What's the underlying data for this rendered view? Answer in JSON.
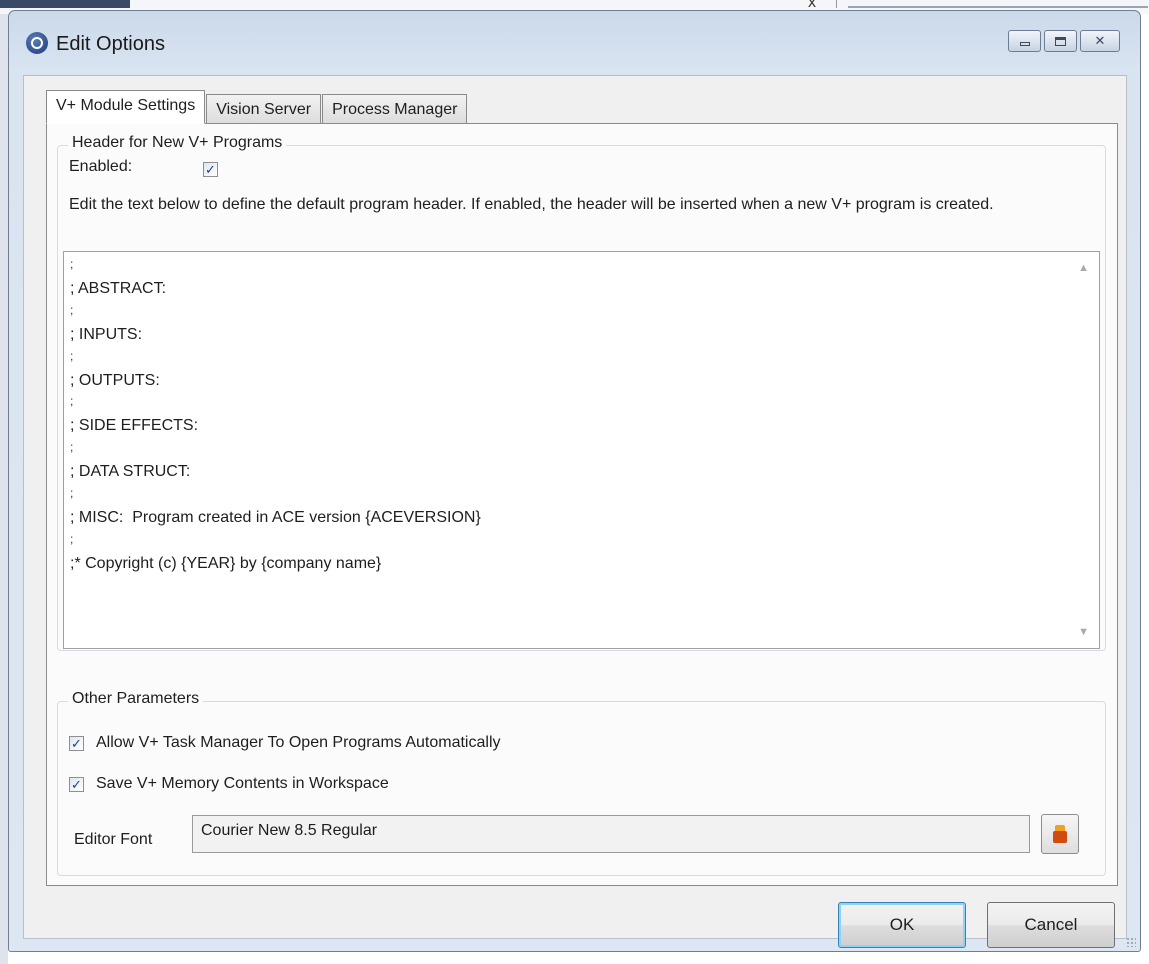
{
  "window": {
    "title": "Edit Options",
    "app_icon": "ace-logo-icon",
    "caption_buttons": [
      "minimize",
      "maximize",
      "close"
    ]
  },
  "tabs": [
    {
      "label": "V+ Module Settings",
      "selected": true
    },
    {
      "label": "Vision Server",
      "selected": false
    },
    {
      "label": "Process Manager",
      "selected": false
    }
  ],
  "header_group": {
    "title": "Header for New V+ Programs",
    "enabled_label": "Enabled:",
    "enabled_checked": true,
    "description": "Edit the text below to define the default program header. If enabled, the header will be inserted when a new V+ program is created.",
    "lines": [
      "; ABSTRACT:",
      "; INPUTS:",
      "; OUTPUTS:",
      "; SIDE EFFECTS:",
      "; DATA STRUCT:",
      "; MISC:  Program created in ACE version {ACEVERSION}",
      ";* Copyright (c) {YEAR} by {company name}"
    ]
  },
  "other_group": {
    "title": "Other Parameters",
    "allow_task_manager_label": "Allow V+ Task Manager To Open Programs Automatically",
    "allow_task_manager_checked": true,
    "save_memory_label": "Save V+ Memory Contents in Workspace",
    "save_memory_checked": true,
    "editor_font_label": "Editor Font",
    "editor_font_value": "Courier New  8.5  Regular"
  },
  "buttons": {
    "ok": "OK",
    "cancel": "Cancel"
  },
  "colors": {
    "title_bar": "#d6e2f0",
    "client_bg": "#f0f0f0",
    "checkmark": "#243c89",
    "default_button_glow": "#8ed2f8"
  }
}
